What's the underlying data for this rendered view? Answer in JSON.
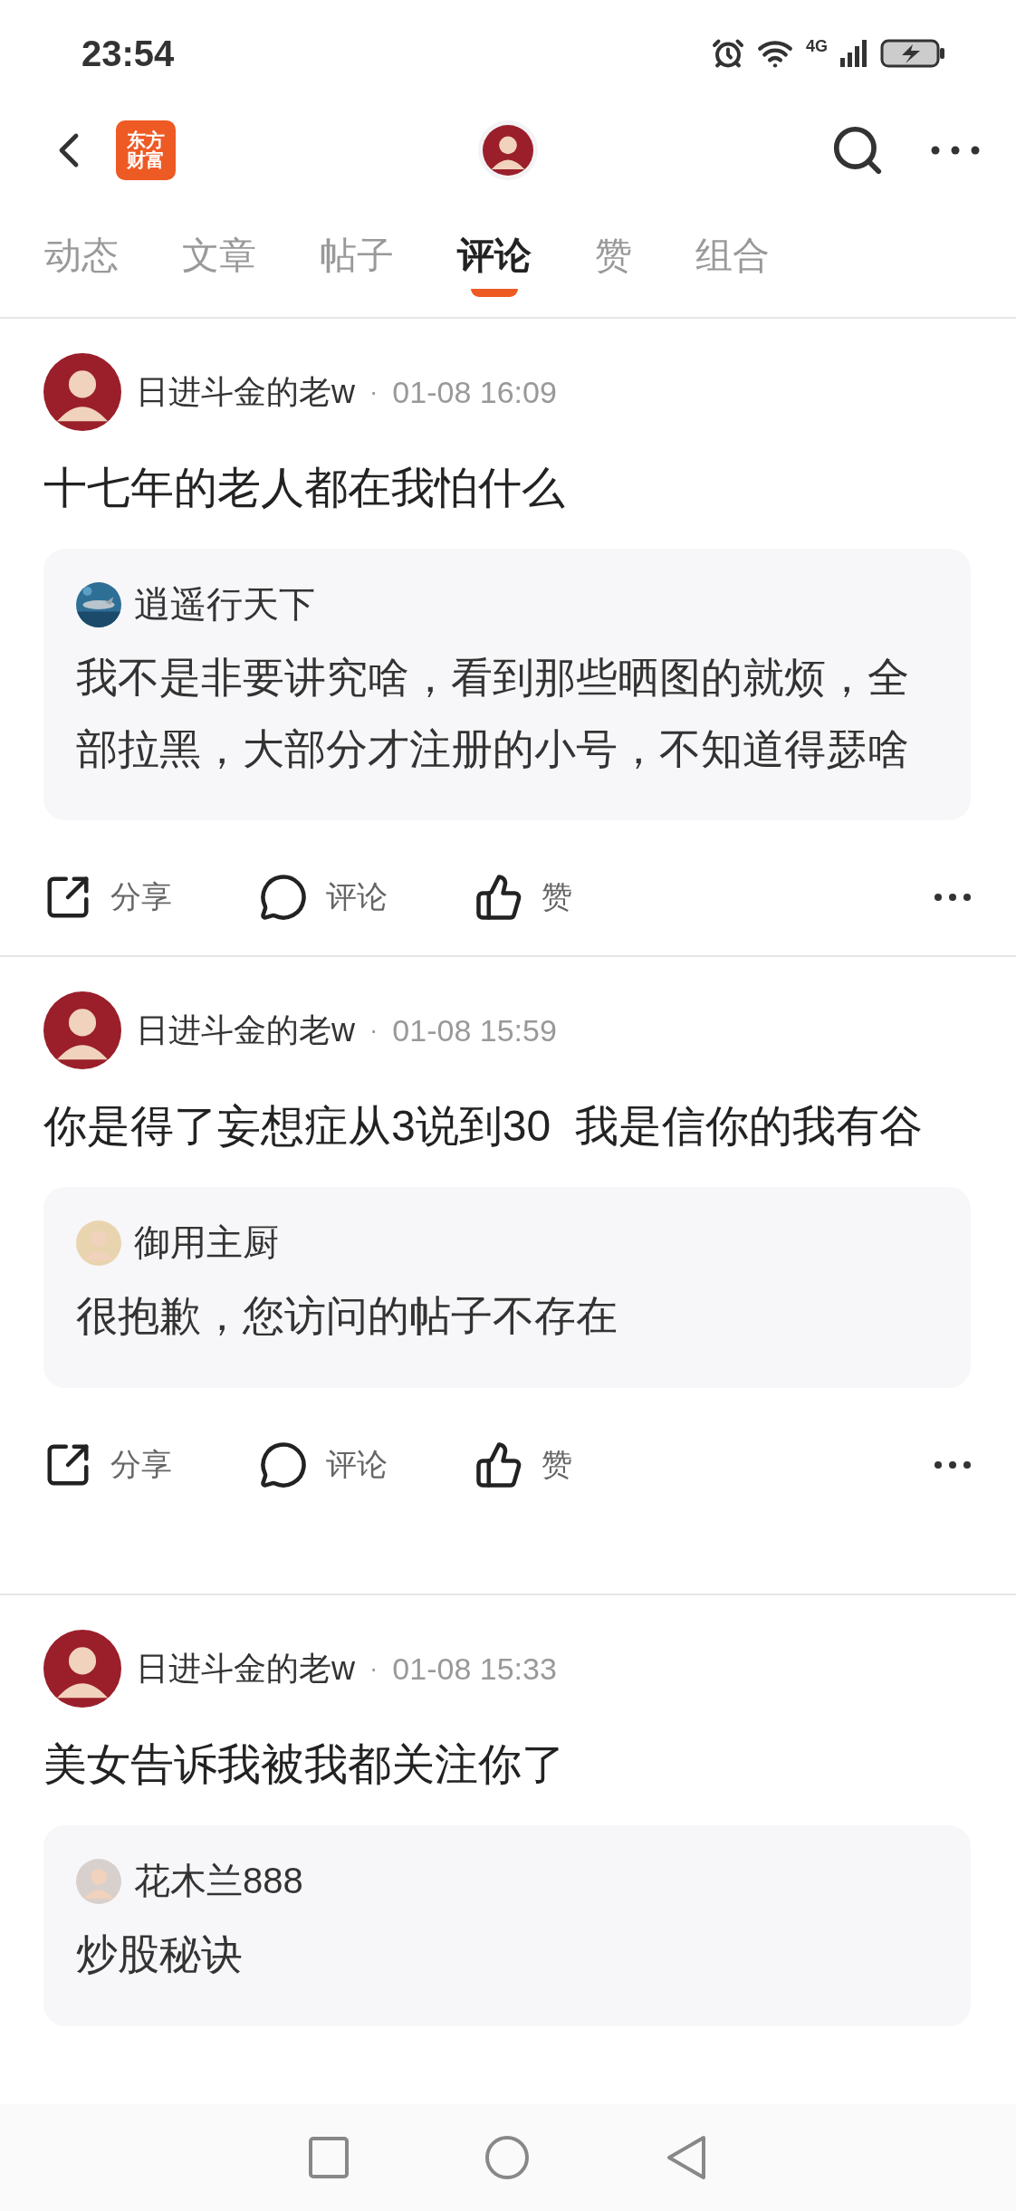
{
  "status_bar": {
    "time": "23:54",
    "network": "4G"
  },
  "header": {
    "logo_lines": [
      "东方",
      "财富"
    ]
  },
  "tabs": [
    {
      "label": "动态",
      "selected": false
    },
    {
      "label": "文章",
      "selected": false
    },
    {
      "label": "帖子",
      "selected": false
    },
    {
      "label": "评论",
      "selected": true
    },
    {
      "label": "赞",
      "selected": false
    },
    {
      "label": "组合",
      "selected": false
    }
  ],
  "comments": [
    {
      "author": "日进斗金的老w",
      "separator": "·",
      "time": "01-08 16:09",
      "text": "十七年的老人都在我怕什么",
      "quote": {
        "author": "逍遥行天下",
        "text": "我不是非要讲究啥，看到那些晒图的就烦，全部拉黑，大部分才注册的小号，不知道得瑟啥"
      },
      "actions": [
        "分享",
        "评论",
        "赞"
      ]
    },
    {
      "author": "日进斗金的老w",
      "separator": "·",
      "time": "01-08 15:59",
      "text": "你是得了妄想症从3说到30  我是信你的我有谷",
      "quote": {
        "author": "御用主厨",
        "text": "很抱歉，您访问的帖子不存在"
      },
      "actions": [
        "分享",
        "评论",
        "赞"
      ]
    },
    {
      "author": "日进斗金的老w",
      "separator": "·",
      "time": "01-08 15:33",
      "text": "美女告诉我被我都关注你了",
      "quote": {
        "author": "花木兰888",
        "text": "炒股秘诀"
      }
    }
  ]
}
